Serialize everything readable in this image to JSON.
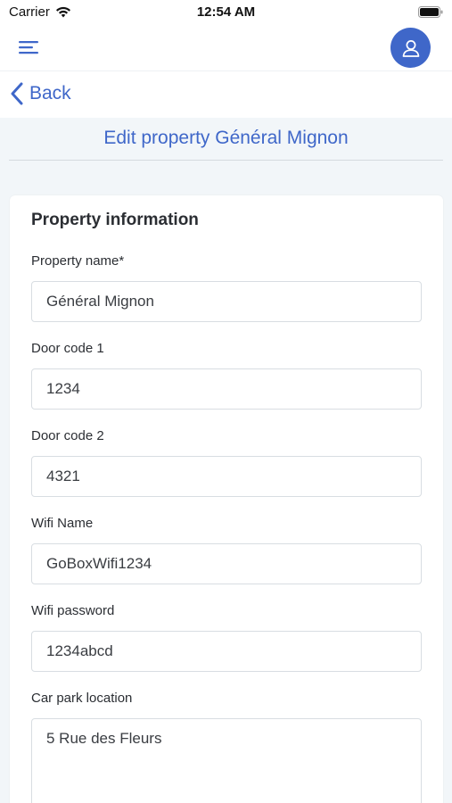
{
  "status_bar": {
    "carrier": "Carrier",
    "time": "12:54 AM",
    "icons": [
      "wifi-icon",
      "battery-icon"
    ]
  },
  "nav": {
    "menu_icon": "hamburger-menu-icon",
    "avatar_icon": "user-icon",
    "accent_color": "#3f67c9"
  },
  "back": {
    "label": "Back"
  },
  "page": {
    "title": "Edit property Général Mignon"
  },
  "form": {
    "section_title": "Property information",
    "fields": [
      {
        "label": "Property name*",
        "value": "Général Mignon"
      },
      {
        "label": "Door code 1",
        "value": "1234"
      },
      {
        "label": "Door code 2",
        "value": "4321"
      },
      {
        "label": "Wifi Name",
        "value": "GoBoxWifi1234"
      },
      {
        "label": "Wifi password",
        "value": "1234abcd"
      },
      {
        "label": "Car park location",
        "value": "5 Rue des Fleurs"
      }
    ]
  }
}
